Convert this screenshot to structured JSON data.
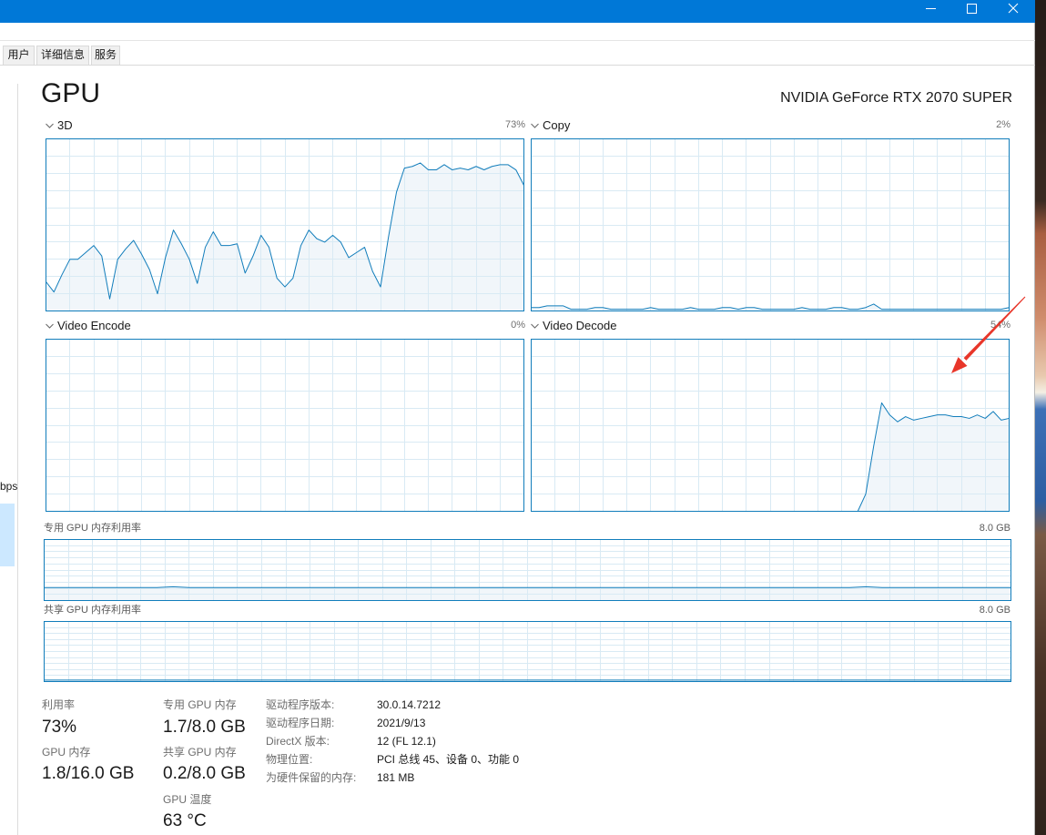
{
  "window_controls": {
    "minimize_icon": "minimize-icon",
    "maximize_icon": "maximize-icon",
    "close_icon": "close-icon"
  },
  "tabs": [
    "用户",
    "详细信息",
    "服务"
  ],
  "sidebar": {
    "partial_label": "bps"
  },
  "header": {
    "title": "GPU",
    "device_name": "NVIDIA GeForce RTX 2070 SUPER"
  },
  "engine_range_percent": [
    0,
    100
  ],
  "engines": [
    {
      "label": "3D",
      "value": "73%",
      "series": [
        17,
        11,
        21,
        30,
        30,
        34,
        38,
        32,
        7,
        30,
        36,
        41,
        33,
        24,
        10,
        31,
        47,
        39,
        30,
        16,
        37,
        46,
        38,
        38,
        39,
        22,
        32,
        44,
        37,
        19,
        14,
        19,
        38,
        47,
        42,
        40,
        44,
        40,
        31,
        34,
        37,
        23,
        14,
        43,
        69,
        83,
        84,
        86,
        82,
        82,
        85,
        82,
        83,
        82,
        84,
        82,
        84,
        85,
        85,
        82,
        73
      ]
    },
    {
      "label": "Copy",
      "value": "2%",
      "series": [
        2,
        2,
        3,
        3,
        3,
        1,
        1,
        1,
        2,
        2,
        1,
        1,
        1,
        1,
        1,
        2,
        1,
        1,
        1,
        1,
        2,
        1,
        1,
        1,
        2,
        2,
        1,
        2,
        2,
        1,
        1,
        1,
        1,
        1,
        2,
        1,
        1,
        1,
        2,
        2,
        1,
        1,
        2,
        4,
        1,
        1,
        1,
        1,
        1,
        1,
        1,
        1,
        1,
        1,
        1,
        1,
        1,
        1,
        1,
        1,
        2
      ]
    },
    {
      "label": "Video Encode",
      "value": "0%",
      "series": [
        0,
        0,
        0,
        0,
        0,
        0,
        0,
        0,
        0,
        0,
        0,
        0,
        0,
        0,
        0,
        0,
        0,
        0,
        0,
        0,
        0,
        0,
        0,
        0,
        0,
        0,
        0,
        0,
        0,
        0,
        0,
        0,
        0,
        0,
        0,
        0,
        0,
        0,
        0,
        0,
        0,
        0,
        0,
        0,
        0,
        0,
        0,
        0,
        0,
        0,
        0,
        0,
        0,
        0,
        0,
        0,
        0,
        0,
        0,
        0,
        0
      ]
    },
    {
      "label": "Video Decode",
      "value": "54%",
      "series": [
        0,
        0,
        0,
        0,
        0,
        0,
        0,
        0,
        0,
        0,
        0,
        0,
        0,
        0,
        0,
        0,
        0,
        0,
        0,
        0,
        0,
        0,
        0,
        0,
        0,
        0,
        0,
        0,
        0,
        0,
        0,
        0,
        0,
        0,
        0,
        0,
        0,
        0,
        0,
        0,
        0,
        0,
        10,
        38,
        63,
        56,
        52,
        55,
        53,
        54,
        55,
        56,
        56,
        55,
        55,
        54,
        56,
        54,
        58,
        53,
        54
      ]
    }
  ],
  "memory": [
    {
      "label": "专用 GPU 内存利用率",
      "capacity": "8.0 GB",
      "capacity_gb": 8,
      "usage_gb": [
        1.7,
        1.7,
        1.7,
        1.7,
        1.7,
        1.7,
        1.7,
        1.7,
        1.8,
        1.7,
        1.7,
        1.7,
        1.7,
        1.7,
        1.7,
        1.7,
        1.7,
        1.7,
        1.7,
        1.7,
        1.7,
        1.7,
        1.7,
        1.7,
        1.7,
        1.7,
        1.7,
        1.7,
        1.7,
        1.7,
        1.7,
        1.7,
        1.7,
        1.7,
        1.7,
        1.7,
        1.7,
        1.7,
        1.7,
        1.7,
        1.7,
        1.7,
        1.7,
        1.7,
        1.7,
        1.7,
        1.7,
        1.7,
        1.7,
        1.7,
        1.7,
        1.8,
        1.7,
        1.7,
        1.7,
        1.7,
        1.7,
        1.7,
        1.7,
        1.7,
        1.7
      ]
    },
    {
      "label": "共享 GPU 内存利用率",
      "capacity": "8.0 GB",
      "capacity_gb": 8,
      "usage_gb": [
        0.2,
        0.2,
        0.2,
        0.2,
        0.2,
        0.2,
        0.2,
        0.2,
        0.2,
        0.2,
        0.2,
        0.2,
        0.2,
        0.2,
        0.2,
        0.2,
        0.2,
        0.2,
        0.2,
        0.2,
        0.2,
        0.2,
        0.2,
        0.2,
        0.2,
        0.2,
        0.2,
        0.2,
        0.2,
        0.2,
        0.2,
        0.2,
        0.2,
        0.2,
        0.2,
        0.2,
        0.2,
        0.2,
        0.2,
        0.2,
        0.2,
        0.2,
        0.2,
        0.2,
        0.2,
        0.2,
        0.2,
        0.2,
        0.2,
        0.2,
        0.2,
        0.2,
        0.2,
        0.2,
        0.2,
        0.2,
        0.2,
        0.2,
        0.2,
        0.2,
        0.2
      ]
    }
  ],
  "stats": {
    "utilization": {
      "label": "利用率",
      "value": "73%"
    },
    "gpu_memory": {
      "label": "GPU 内存",
      "value": "1.8/16.0 GB"
    },
    "dedicated_memory": {
      "label": "专用 GPU 内存",
      "value": "1.7/8.0 GB"
    },
    "shared_memory": {
      "label": "共享 GPU 内存",
      "value": "0.2/8.0 GB"
    },
    "temperature": {
      "label": "GPU 温度",
      "value": "63 °C"
    }
  },
  "info": [
    {
      "label": "驱动程序版本:",
      "value": "30.0.14.7212"
    },
    {
      "label": "驱动程序日期:",
      "value": "2021/9/13"
    },
    {
      "label": "DirectX 版本:",
      "value": "12 (FL 12.1)"
    },
    {
      "label": "物理位置:",
      "value": "PCI 总线 45、设备 0、功能 0"
    },
    {
      "label": "为硬件保留的内存:",
      "value": "181 MB"
    }
  ],
  "colors": {
    "titlebar": "#0078d7",
    "graph_line": "#117dbb",
    "graph_grid": "#d9eaf4",
    "graph_fill": "#f1f6fa",
    "selection": "#cce8ff",
    "annotation_arrow": "#e8362a"
  }
}
